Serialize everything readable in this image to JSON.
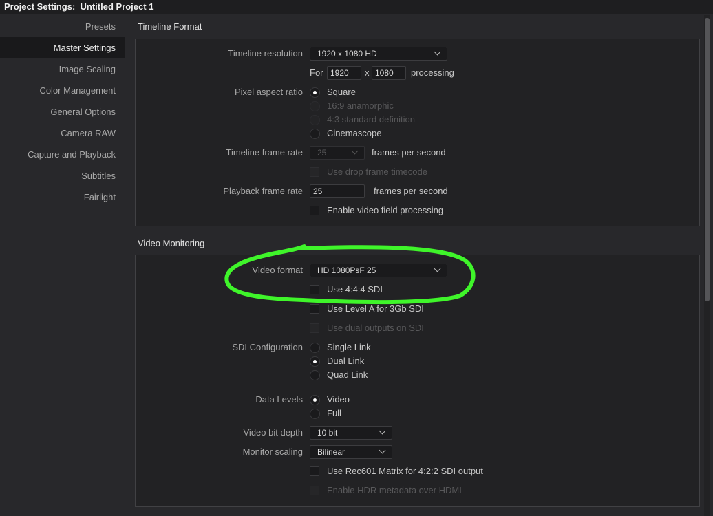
{
  "window": {
    "title": "Project Settings:  Untitled Project 1"
  },
  "sidebar": {
    "items": [
      {
        "label": "Presets"
      },
      {
        "label": "Master Settings"
      },
      {
        "label": "Image Scaling"
      },
      {
        "label": "Color Management"
      },
      {
        "label": "General Options"
      },
      {
        "label": "Camera RAW"
      },
      {
        "label": "Capture and Playback"
      },
      {
        "label": "Subtitles"
      },
      {
        "label": "Fairlight"
      }
    ],
    "active": "Master Settings"
  },
  "timeline_format": {
    "title": "Timeline Format",
    "resolution_label": "Timeline resolution",
    "resolution_value": "1920 x 1080 HD",
    "for_label": "For",
    "width_value": "1920",
    "x_label": "x",
    "height_value": "1080",
    "processing_label": "processing",
    "pixel_aspect_label": "Pixel aspect ratio",
    "pixel_aspect_options": [
      "Square",
      "16:9 anamorphic",
      "4:3 standard definition",
      "Cinemascope"
    ],
    "pixel_aspect_selected": "Square",
    "frame_rate_label": "Timeline frame rate",
    "frame_rate_value": "25",
    "fps_label": "frames per second",
    "drop_frame_label": "Use drop frame timecode",
    "playback_rate_label": "Playback frame rate",
    "playback_rate_value": "25",
    "playback_fps_label": "frames per second",
    "field_processing_label": "Enable video field processing"
  },
  "video_monitoring": {
    "title": "Video Monitoring",
    "video_format_label": "Video format",
    "video_format_value": "HD 1080PsF 25",
    "use_444_label": "Use 4:4:4 SDI",
    "level_a_label": "Use Level A for 3Gb SDI",
    "dual_outputs_label": "Use dual outputs on SDI",
    "sdi_config_label": "SDI Configuration",
    "sdi_options": [
      "Single Link",
      "Dual Link",
      "Quad Link"
    ],
    "sdi_selected": "Dual Link",
    "data_levels_label": "Data Levels",
    "data_levels_options": [
      "Video",
      "Full"
    ],
    "data_levels_selected": "Video",
    "bit_depth_label": "Video bit depth",
    "bit_depth_value": "10 bit",
    "monitor_scaling_label": "Monitor scaling",
    "monitor_scaling_value": "Bilinear",
    "rec601_label": "Use Rec601 Matrix for 4:2:2 SDI output",
    "hdr_metadata_label": "Enable HDR metadata over HDMI"
  },
  "colors": {
    "background": "#28282b",
    "panel": "#222224",
    "annotation_highlight": "#3ff52a"
  }
}
